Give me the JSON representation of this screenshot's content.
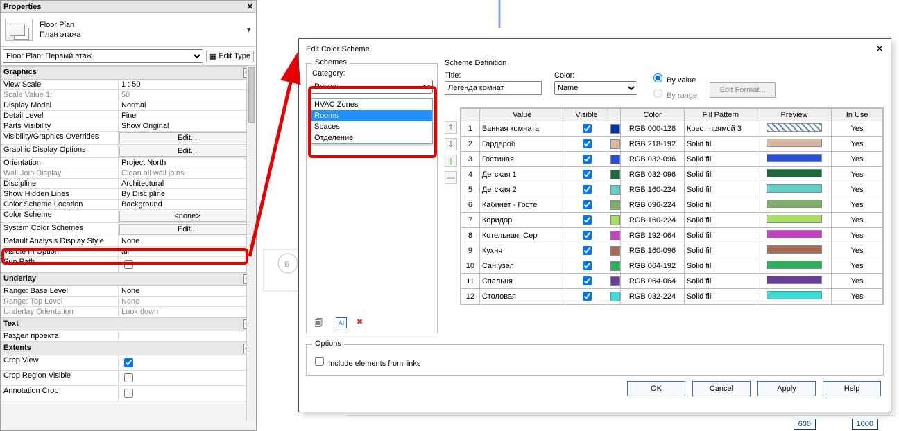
{
  "properties": {
    "title": "Properties",
    "type": {
      "line1": "Floor Plan",
      "line2": "План этажа"
    },
    "instance": "Floor Plan: Первый этаж",
    "edit_type": "Edit Type",
    "groups": [
      {
        "name": "Graphics",
        "rows": [
          {
            "k": "View Scale",
            "v": "1 : 50"
          },
          {
            "k": "Scale Value    1:",
            "v": "50",
            "dim": true
          },
          {
            "k": "Display Model",
            "v": "Normal"
          },
          {
            "k": "Detail Level",
            "v": "Fine"
          },
          {
            "k": "Parts Visibility",
            "v": "Show Original"
          },
          {
            "k": "Visibility/Graphics Overrides",
            "v": "Edit...",
            "btn": true
          },
          {
            "k": "Graphic Display Options",
            "v": "Edit...",
            "btn": true
          },
          {
            "k": "Orientation",
            "v": "Project North"
          },
          {
            "k": "Wall Join Display",
            "v": "Clean all wall joins",
            "dim": true
          },
          {
            "k": "Discipline",
            "v": "Architectural"
          },
          {
            "k": "Show Hidden Lines",
            "v": "By Discipline"
          },
          {
            "k": "Color Scheme Location",
            "v": "Background"
          },
          {
            "k": "Color Scheme",
            "v": "<none>",
            "btn": true,
            "hl": true
          },
          {
            "k": "System Color Schemes",
            "v": "Edit...",
            "btn": true
          },
          {
            "k": "Default Analysis Display Style",
            "v": "None"
          },
          {
            "k": "Visible In Option",
            "v": "all"
          },
          {
            "k": "Sun Path",
            "v": "",
            "chk": false
          }
        ]
      },
      {
        "name": "Underlay",
        "rows": [
          {
            "k": "Range: Base Level",
            "v": "None"
          },
          {
            "k": "Range: Top Level",
            "v": "None",
            "dim": true
          },
          {
            "k": "Underlay Orientation",
            "v": "Look down",
            "dim": true
          }
        ]
      },
      {
        "name": "Text",
        "rows": [
          {
            "k": "Раздел проекта",
            "v": ""
          }
        ]
      },
      {
        "name": "Extents",
        "rows": [
          {
            "k": "Crop View",
            "v": "",
            "chk": true
          },
          {
            "k": "Crop Region Visible",
            "v": "",
            "chk": false
          },
          {
            "k": "Annotation Crop",
            "v": "",
            "chk": false
          }
        ]
      }
    ]
  },
  "dialog": {
    "title": "Edit Color Scheme",
    "schemes": {
      "legend": "Schemes",
      "category_label": "Category:",
      "category_value": "Rooms",
      "dropdown": [
        "HVAC Zones",
        "Rooms",
        "Spaces",
        "Отделение"
      ],
      "selected": "Rooms"
    },
    "definition": {
      "legend": "Scheme Definition",
      "title_label": "Title:",
      "title_value": "Легенда комнат",
      "color_label": "Color:",
      "color_value": "Name",
      "by_value": "By value",
      "by_range": "By range",
      "edit_format": "Edit Format...",
      "headers": [
        "",
        "Value",
        "Visible",
        "",
        "Color",
        "Fill Pattern",
        "Preview",
        "In Use"
      ],
      "rows": [
        {
          "n": 1,
          "val": "Ванная комната",
          "vis": true,
          "sw": "#0033aa",
          "rgb": "RGB 000-128",
          "fp": "Крест прямой 3",
          "prev": "cross",
          "prevc": "#0033aa",
          "use": "Yes"
        },
        {
          "n": 2,
          "val": "Гардероб",
          "vis": true,
          "sw": "#d9b8a0",
          "rgb": "RGB 218-192",
          "fp": "Solid fill",
          "prev": "solid",
          "prevc": "#d9b8a0",
          "use": "Yes"
        },
        {
          "n": 3,
          "val": "Гостиная",
          "vis": true,
          "sw": "#2a4fd6",
          "rgb": "RGB 032-096",
          "fp": "Solid fill",
          "prev": "solid",
          "prevc": "#2a4fd6",
          "use": "Yes"
        },
        {
          "n": 4,
          "val": "Детская 1",
          "vis": true,
          "sw": "#1e6b3e",
          "rgb": "RGB 032-096",
          "fp": "Solid fill",
          "prev": "solid",
          "prevc": "#1e6b3e",
          "use": "Yes"
        },
        {
          "n": 5,
          "val": "Детская 2",
          "vis": true,
          "sw": "#5ed0c9",
          "rgb": "RGB 160-224",
          "fp": "Solid fill",
          "prev": "solid",
          "prevc": "#5ed0c9",
          "use": "Yes"
        },
        {
          "n": 6,
          "val": "Кабинет - Госте",
          "vis": true,
          "sw": "#80b06b",
          "rgb": "RGB 096-224",
          "fp": "Solid fill",
          "prev": "solid",
          "prevc": "#80b06b",
          "use": "Yes"
        },
        {
          "n": 7,
          "val": "Коридор",
          "vis": true,
          "sw": "#a4e05a",
          "rgb": "RGB 160-224",
          "fp": "Solid fill",
          "prev": "solid",
          "prevc": "#a4e05a",
          "use": "Yes"
        },
        {
          "n": 8,
          "val": "Котельная, Сер",
          "vis": true,
          "sw": "#c83fc5",
          "rgb": "RGB 192-064",
          "fp": "Solid fill",
          "prev": "solid",
          "prevc": "#c83fc5",
          "use": "Yes"
        },
        {
          "n": 9,
          "val": "Кухня",
          "vis": true,
          "sw": "#a96b50",
          "rgb": "RGB 160-096",
          "fp": "Solid fill",
          "prev": "solid",
          "prevc": "#a96b50",
          "use": "Yes"
        },
        {
          "n": 10,
          "val": "Сан.узел",
          "vis": true,
          "sw": "#25b25a",
          "rgb": "RGB 064-192",
          "fp": "Solid fill",
          "prev": "solid",
          "prevc": "#25b25a",
          "use": "Yes"
        },
        {
          "n": 11,
          "val": "Спальня",
          "vis": true,
          "sw": "#6a3f99",
          "rgb": "RGB 064-064",
          "fp": "Solid fill",
          "prev": "solid",
          "prevc": "#6a3f99",
          "use": "Yes"
        },
        {
          "n": 12,
          "val": "Столовая",
          "vis": true,
          "sw": "#38ded6",
          "rgb": "RGB 032-224",
          "fp": "Solid fill",
          "prev": "solid",
          "prevc": "#38ded6",
          "use": "Yes"
        }
      ]
    },
    "options": {
      "legend": "Options",
      "include": "Include elements from links",
      "checked": false
    },
    "buttons": {
      "ok": "OK",
      "cancel": "Cancel",
      "apply": "Apply",
      "help": "Help"
    }
  },
  "canvas": {
    "dim600": "600",
    "dim1000": "1000",
    "tag_b": "Б"
  }
}
